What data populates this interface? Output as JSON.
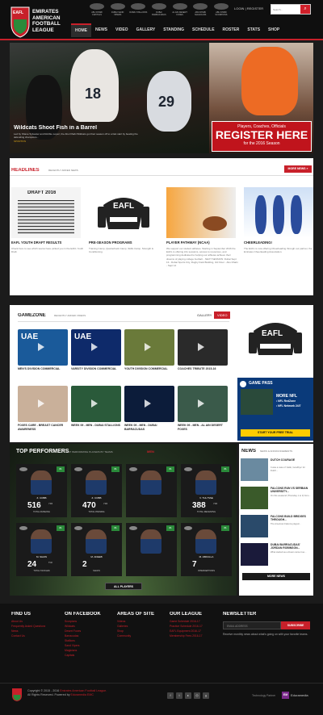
{
  "header": {
    "logo_text": "EAFL",
    "logo_league": "EMIRATES AMERICAN FOOTBALL LEAGUE",
    "teams": [
      "ABU DHABI CAPITALS",
      "DUBAI SAND VIPERS",
      "DUBAI STALLIONS",
      "DUBAI BARRACUDAS",
      "AL AIN DESERT FOXES",
      "ABU DHABI MAGICIANS",
      "ABU DHABI SCORPIONS"
    ],
    "login": "LOGIN",
    "register": "REGISTER",
    "search_placeholder": "Search...",
    "nav": [
      "HOME",
      "NEWS",
      "VIDEO",
      "GALLERY",
      "STANDING",
      "SCHEDULE",
      "ROSTER",
      "STATS",
      "SHOP"
    ]
  },
  "hero": {
    "title": "Wildcats Shoot Fish in a Barrel",
    "desc": "Led by Shane Sylvester and Robbie Lopez, the Abu Dhabi Wildcats got their season off to a fast start by beating the defending champions...",
    "tag": "SPORTFIN",
    "jersey_a": "18",
    "jersey_b": "29",
    "ad_line1": "Players, Coaches, Officials",
    "ad_line2": "REGISTER HERE",
    "ad_line3": "for the 2016 Season",
    "accent": "#c8202a"
  },
  "headlines": {
    "title": "HEADLINES",
    "subtitle": "RECENTLY ADDED NEWS",
    "more": "MORE NEWS »",
    "cards": [
      {
        "title": "EAFL YOUTH DRAFT RESULTS",
        "desc": "Check here to see which teams have picked you in the EAFL Youth Draft.",
        "img_label": "DRAFT 2016"
      },
      {
        "title": "PRE-SEASON PROGRAMS",
        "desc": "Training Camp, Quarterback Camp, Skills Camp, Strength & Conditioning.",
        "img_label": "EAFL"
      },
      {
        "title": "PLAYER PATHWAY (NCAA)",
        "desc": "We support our student athletes. Starting in September 2016 the EAFL is offering info sessions, access to resources, and programming dedicated to helping our athletes achieve their dreams of playing college football. - NEXT SESSION: Dubai Sept 13 - Dubai Sports City, Rugby Field Building, 3rd Floor - Abu Dhabi - Sept 14",
        "img_label": ""
      },
      {
        "title": "CHEERLEADING!",
        "desc": "The EAFL is now offering Cheerleading through our partner, the Emirates Cheerleading Association.",
        "img_label": ""
      }
    ]
  },
  "gamezone": {
    "title": "GAMEZONE",
    "subtitle": "RECENTLY ADDED VIDEOS",
    "tabs": [
      "GALLERY",
      "VIDEO"
    ],
    "videos": [
      {
        "title": "MEN'S DIVISION COMMERCIAL",
        "label": "UAE"
      },
      {
        "title": "VARSITY DIVISION COMMERCIAL",
        "label": "UAE"
      },
      {
        "title": "YOUTH DIVISION COMMERCIAL",
        "label": ""
      },
      {
        "title": "COACHES TRIBUTE 2015-16",
        "label": ""
      },
      {
        "title": "FOXES CARE - BREAST CANCER AWARENESS",
        "label": ""
      },
      {
        "title": "WEEK 09 - MEN - DUBAI STALLIONS",
        "label": ""
      },
      {
        "title": "WEEK 09 - MEN - DUBAI BARRACUDAS",
        "label": ""
      },
      {
        "title": "WEEK 09 - MEN - AL AIN DESERT FOXES",
        "label": ""
      }
    ],
    "side_ad_text": "EAFL",
    "gamepass": "GAME PASS",
    "gamepass_lines": [
      "MORE NFL",
      "• NFL RedZone",
      "• NFL Network 24/7"
    ],
    "gamepass_cta": "START YOUR FREE TRIAL"
  },
  "top_performers": {
    "title": "TOP PERFORMERS",
    "subtitle": "TOP PERFORMING PLAYERS BY TEAMS",
    "tab": "MEN",
    "all_button": "ALL PLAYERS",
    "players": [
      {
        "rank": "#1",
        "name": "Z. COBB",
        "stat": "516",
        "unit": "YDS",
        "label": "TOTAL RUSHING"
      },
      {
        "rank": "#1",
        "name": "Z. COBB",
        "stat": "470",
        "unit": "YDS",
        "label": "TOTAL PASSING"
      },
      {
        "rank": "#1",
        "name": "",
        "stat": "",
        "unit": "",
        "label": ""
      },
      {
        "rank": "#1",
        "name": "V. TULYSSE",
        "stat": "388",
        "unit": "YDS",
        "label": "TOTAL RECEIVING"
      },
      {
        "rank": "#1",
        "name": "M. SHAW",
        "stat": "24",
        "unit": "TCK",
        "label": "TOTAL TACKLES"
      },
      {
        "rank": "#1",
        "name": "M. ADEEB",
        "stat": "2",
        "unit": "",
        "label": "SACKS"
      },
      {
        "rank": "#1",
        "name": "",
        "stat": "",
        "unit": "",
        "label": ""
      },
      {
        "rank": "#1",
        "name": "M. ABDULLA",
        "stat": "7",
        "unit": "",
        "label": "INTERCEPTIONS"
      }
    ]
  },
  "news": {
    "title": "NEWS",
    "subtitle": "NEWS & ANNOUNCEMENTS",
    "more": "MORE NEWS",
    "items": [
      {
        "title": "DUTCH COURAGE",
        "desc": "It was a case of 'Hello, Goodbye' for Dutch..."
      },
      {
        "title": "FALCONS RUN VS SERBIAN UNIVERSITY...",
        "desc": "On this weekend (Thursday 1 to 3) from..."
      },
      {
        "title": "FALCONS BUILD BRIDGES THROUGH...",
        "desc": "The American Falcons played..."
      },
      {
        "title": "DUBAI BARRACUDAS' JORDAN ROBINSON...",
        "desc": "What started as a dream came true..."
      }
    ]
  },
  "footer": {
    "find_us": "FIND US",
    "find_links": [
      "About Us",
      "Frequently Asked Questions",
      "News",
      "Contact Us"
    ],
    "facebook": "ON FACEBOOK",
    "facebook_links": [
      "Scorpions",
      "Wildcats",
      "Desert Foxes",
      "Barracudas",
      "Stallions",
      "Sand Vipers",
      "Magicians",
      "Capitals"
    ],
    "areas": "AREAS OF SITE",
    "areas_links": [
      "Videos",
      "Galleries",
      "Shop",
      "Community"
    ],
    "league": "OUR LEAGUE",
    "league_links": [
      "Game Schedule 2016-17",
      "Practice Schedule 2016-17",
      "EAFL Equipment 2016-17",
      "Membership Fees 2016-17"
    ],
    "newsletter": "NEWSLETTER",
    "email_placeholder": "EMAIL ADDRESS",
    "subscribe": "SUBSCRIBE",
    "newsletter_desc": "Receive monthly news about what's going on with your favorite teams.",
    "copyright_a": "Copyright © 2015 - 2016",
    "copyright_link": "Emirates American Football League.",
    "copyright_b": "All Rights Reserved. Powered by",
    "powered": "Eduramedia EMC",
    "tech_partner": "Technology Partner",
    "partner_badge": "EM",
    "partner_name": "Eduramedia"
  }
}
